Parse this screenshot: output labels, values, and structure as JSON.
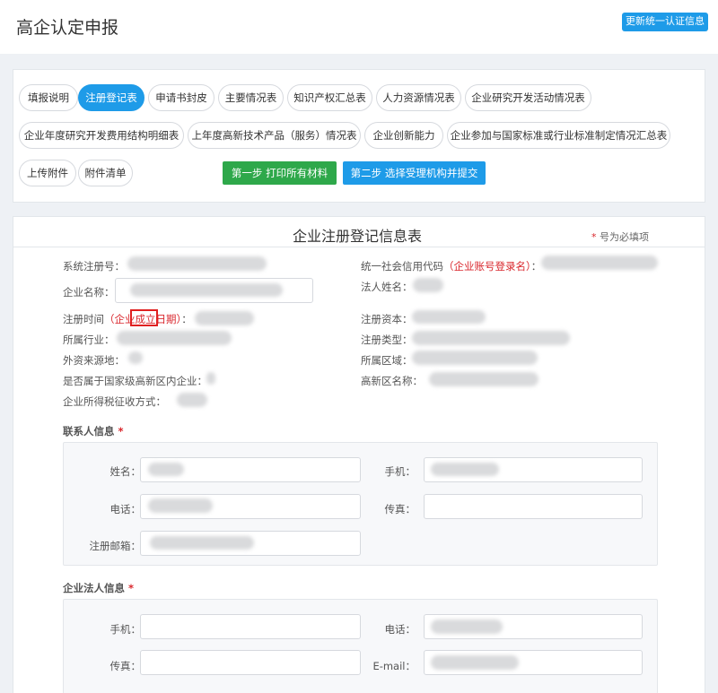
{
  "header": {
    "title": "高企认定申报",
    "update_button": "更新统一认证信息"
  },
  "tabs": [
    "填报说明",
    "注册登记表",
    "申请书封皮",
    "主要情况表",
    "知识产权汇总表",
    "人力资源情况表",
    "企业研究开发活动情况表",
    "企业年度研究开发费用结构明细表",
    "上年度高新技术产品（服务）情况表",
    "企业创新能力",
    "企业参加与国家标准或行业标准制定情况汇总表",
    "上传附件",
    "附件清单"
  ],
  "active_tab": "注册登记表",
  "steps": {
    "step1": "第一步 打印所有材料",
    "step2": "第二步 选择受理机构并提交"
  },
  "form": {
    "title": "企业注册登记信息表",
    "required_star": "*",
    "required_note": " 号为必填项",
    "fields": {
      "system_reg_no": "系统注册号：",
      "credit_code": "统一社会信用代码",
      "credit_code_note": "（企业账号登录名）",
      "credit_code_colon": "：",
      "company_name": "企业名称：",
      "legal_person_name": "法人姓名：",
      "reg_time": "注册时间",
      "reg_time_note": "（企业成立日期）",
      "reg_time_colon": "：",
      "reg_capital": "注册资本：",
      "industry": "所属行业：",
      "reg_type": "注册类型：",
      "foreign_source": "外资来源地：",
      "region": "所属区域：",
      "in_national_zone": "是否属于国家级高新区内企业：",
      "zone_name": "高新区名称：",
      "tax_method": "企业所得税征收方式："
    },
    "contact": {
      "section": "联系人信息",
      "name": "姓名：",
      "mobile": "手机：",
      "phone": "电话：",
      "fax": "传真：",
      "email": "注册邮箱："
    },
    "legal": {
      "section": "企业法人信息",
      "mobile": "手机：",
      "phone": "电话：",
      "fax": "传真：",
      "email": "E-mail："
    }
  },
  "colors": {
    "accent": "#1e9be8",
    "green": "#2ea84a",
    "required": "#d9262c"
  }
}
